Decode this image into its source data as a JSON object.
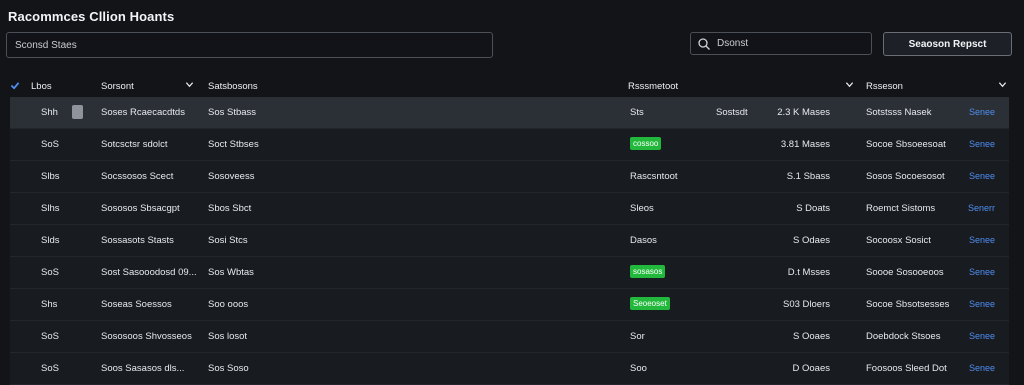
{
  "page": {
    "title": "Racommces Cllion Hoants"
  },
  "filter": {
    "value": "Sconsd Staes"
  },
  "search": {
    "value": "Dsonst"
  },
  "primary_button": {
    "label": "Seaoson Repsct"
  },
  "columns": {
    "col1": "Lbos",
    "col2": "Sorsont",
    "col3": "Satsbosons",
    "col4": "Rsssmetoot",
    "col5": "Rsseson"
  },
  "rows": [
    {
      "id": "Shh",
      "name": "Soses Rcaecacdtds",
      "type": "Sos Stbass",
      "status": "Sts",
      "status_badge": false,
      "col5": "Sostsdt",
      "amount": "2.3 K Mases",
      "owner": "Sotstsss Nasek",
      "action": "Senee",
      "selected": true
    },
    {
      "id": "SoS",
      "name": "Sotcsctsr sdolct",
      "type": "Soct Stbses",
      "status": "cossoo",
      "status_badge": true,
      "col5": "",
      "amount": "3.81 Mases",
      "owner": "Socoe Sbsoeesoat",
      "action": "Senee",
      "selected": false
    },
    {
      "id": "Slbs",
      "name": "Socssosos Scect",
      "type": "Sosoveess",
      "status": "Rascsntoot",
      "status_badge": false,
      "col5": "",
      "amount": "S.1 Sbass",
      "owner": "Sosos Socoesosot",
      "action": "Senee",
      "selected": false
    },
    {
      "id": "Slhs",
      "name": "Sososos Sbsacgpt",
      "type": "Sbos Sbct",
      "status": "Sleos",
      "status_badge": false,
      "col5": "",
      "amount": "S Doats",
      "owner": "Roemct Sistoms",
      "action": "Senerr",
      "selected": false
    },
    {
      "id": "Slds",
      "name": "Sossasots Stasts",
      "type": "Sosi Stcs",
      "status": "Dasos",
      "status_badge": false,
      "col5": "",
      "amount": "S Odaes",
      "owner": "Socoosx Sosict",
      "action": "Senee",
      "selected": false
    },
    {
      "id": "SoS",
      "name": "Sost Sasooodosd 09...",
      "type": "Sos Wbtas",
      "status": "sosasos",
      "status_badge": true,
      "col5": "",
      "amount": "D.t Msses",
      "owner": "Soooe Sosooeoos",
      "action": "Senee",
      "selected": false
    },
    {
      "id": "Shs",
      "name": "Soseas Soessos",
      "type": "Soo ooos",
      "status": "Seoeoset",
      "status_badge": true,
      "col5": "",
      "amount": "S03 Dloers",
      "owner": "Socoe Sbsotsesses",
      "action": "Senee",
      "selected": false
    },
    {
      "id": "SoS",
      "name": "Sososoos Shvosseos",
      "type": "Sos losot",
      "status": "Sor",
      "status_badge": false,
      "col5": "",
      "amount": "S Ooaes",
      "owner": "Doebdock Stsoes",
      "action": "Senee",
      "selected": false
    },
    {
      "id": "SoS",
      "name": "Soos Sasasos dls...",
      "type": "Sos Soso",
      "status": "Soo",
      "status_badge": false,
      "col5": "",
      "amount": "D Ooaes",
      "owner": "Foosoos Sleed Dot",
      "action": "Senee",
      "selected": false
    }
  ],
  "colors": {
    "accent": "#4f8ef0",
    "status_green": "#22b83c",
    "background": "#121418",
    "selected_row": "#2b2f36"
  },
  "icons": {
    "search": "search-icon",
    "sort": "chevron-down-icon",
    "select_all": "check-icon"
  }
}
